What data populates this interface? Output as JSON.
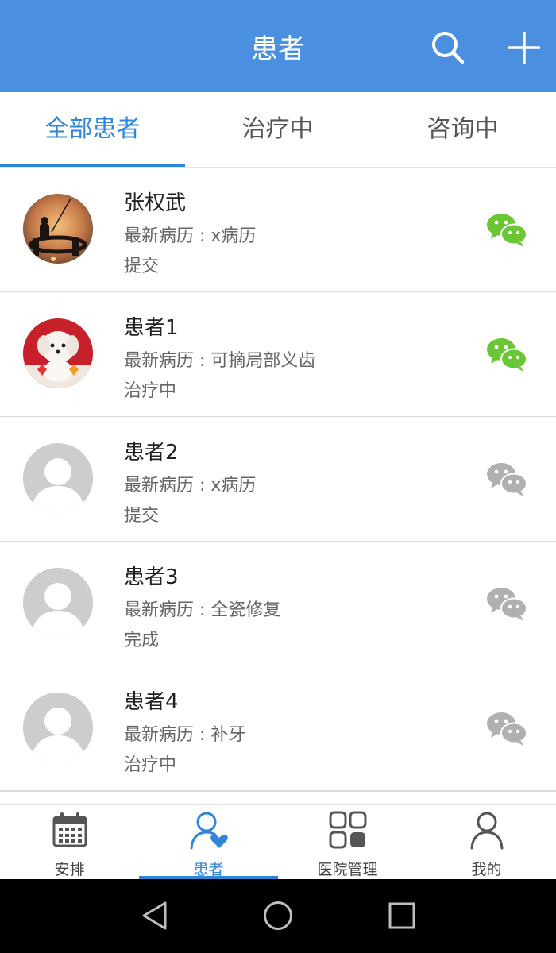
{
  "header": {
    "title": "患者"
  },
  "tabs": [
    {
      "label": "全部患者",
      "active": true
    },
    {
      "label": "治疗中",
      "active": false
    },
    {
      "label": "咨询中",
      "active": false
    }
  ],
  "patients": [
    {
      "name": "张权武",
      "record": "最新病历 : x病历",
      "status": "提交",
      "avatar": "photo-fishing",
      "wechat_color": "#6ac634"
    },
    {
      "name": "患者1",
      "record": "最新病历 : 可摘局部义齿",
      "status": "治疗中",
      "avatar": "photo-puppy",
      "wechat_color": "#6ac634"
    },
    {
      "name": "患者2",
      "record": "最新病历 : x病历",
      "status": "提交",
      "avatar": "default-person",
      "wechat_color": "#b0b0b0"
    },
    {
      "name": "患者3",
      "record": "最新病历 : 全瓷修复",
      "status": "完成",
      "avatar": "default-person",
      "wechat_color": "#b0b0b0"
    },
    {
      "name": "患者4",
      "record": "最新病历 : 补牙",
      "status": "治疗中",
      "avatar": "default-person",
      "wechat_color": "#b0b0b0"
    }
  ],
  "bottom_nav": [
    {
      "label": "安排",
      "icon": "calendar-icon",
      "active": false
    },
    {
      "label": "患者",
      "icon": "patient-heart-icon",
      "active": true
    },
    {
      "label": "医院管理",
      "icon": "grid-icon",
      "active": false
    },
    {
      "label": "我的",
      "icon": "person-icon",
      "active": false
    }
  ],
  "colors": {
    "primary": "#4a8fe0",
    "accent": "#2f86d8",
    "wechat_active": "#6ac634",
    "wechat_inactive": "#b0b0b0"
  }
}
